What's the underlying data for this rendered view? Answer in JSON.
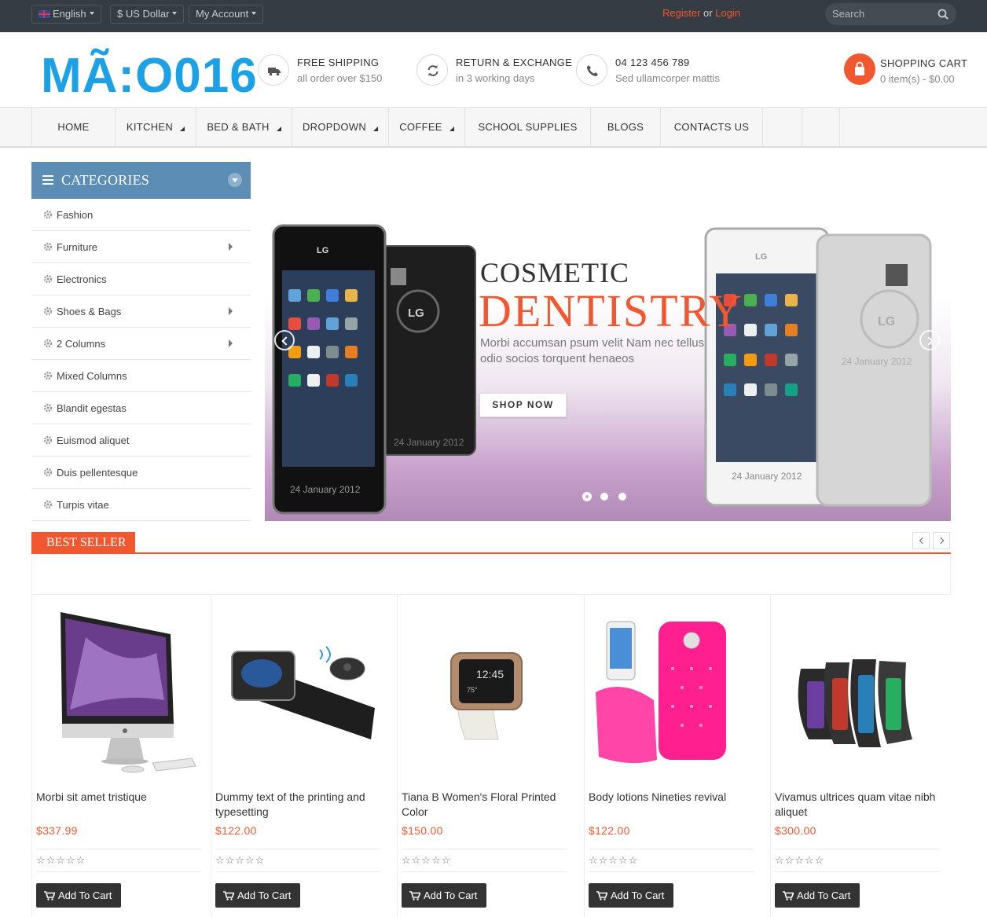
{
  "topbar": {
    "language": "English",
    "currency": "$ US Dollar",
    "account": "My Account",
    "register": "Register",
    "or": "or",
    "login": "Login",
    "search_placeholder": "Search"
  },
  "header": {
    "logo": "MÃ:O016",
    "features": [
      {
        "title": "FREE SHIPPING",
        "sub": "all order over $150",
        "icon": "truck-icon"
      },
      {
        "title": "RETURN & EXCHANGE",
        "sub": "in 3 working days",
        "icon": "refresh-icon"
      },
      {
        "title": "04 123 456 789",
        "sub": "Sed ullamcorper mattis",
        "icon": "phone-icon"
      }
    ],
    "cart_title": "SHOPPING CART",
    "cart_summary": "0 item(s) - $0.00"
  },
  "nav": {
    "items": [
      {
        "label": "HOME",
        "dropdown": false
      },
      {
        "label": "KITCHEN",
        "dropdown": true
      },
      {
        "label": "BED & BATH",
        "dropdown": true
      },
      {
        "label": "DROPDOWN",
        "dropdown": true
      },
      {
        "label": "COFFEE",
        "dropdown": true
      },
      {
        "label": "SCHOOL SUPPLIES",
        "dropdown": false
      },
      {
        "label": "BLOGS",
        "dropdown": false
      },
      {
        "label": "CONTACTS US",
        "dropdown": false
      }
    ]
  },
  "categories": {
    "title": "CATEGORIES",
    "items": [
      {
        "label": "Fashion",
        "submenu": false
      },
      {
        "label": "Furniture",
        "submenu": true
      },
      {
        "label": "Electronics",
        "submenu": false
      },
      {
        "label": "Shoes & Bags",
        "submenu": true
      },
      {
        "label": "2 Columns",
        "submenu": true
      },
      {
        "label": "Mixed Columns",
        "submenu": false
      },
      {
        "label": "Blandit egestas",
        "submenu": false
      },
      {
        "label": "Euismod aliquet",
        "submenu": false
      },
      {
        "label": "Duis pellentesque",
        "submenu": false
      },
      {
        "label": "Turpis vitae",
        "submenu": false
      }
    ]
  },
  "slider": {
    "title1": "COSMETIC",
    "title2": "DENTISTRY",
    "description": "Morbi accumsan psum velit Nam nec tellus odio socios torquent henaeos",
    "button": "SHOP NOW",
    "date_stamp": "24 January 2012",
    "active_slide": 1,
    "slide_count": 3
  },
  "best_seller": {
    "title": "BEST SELLER",
    "add_label": "Add To Cart",
    "rating_stars": "☆☆☆☆☆",
    "products": [
      {
        "name": "Morbi sit amet tristique",
        "price": "$337.99"
      },
      {
        "name": "Dummy text of the printing and typesetting",
        "price": "$122.00"
      },
      {
        "name": "Tiana B Women's Floral Printed Color",
        "price": "$150.00"
      },
      {
        "name": "Body lotions Nineties revival",
        "price": "$122.00"
      },
      {
        "name": "Vivamus ultrices quam vitae nibh aliquet",
        "price": "$300.00"
      }
    ]
  },
  "colors": {
    "accent": "#f1582f",
    "topbar": "#363c44",
    "logo": "#1da1e6",
    "categories_header": "#5b8db5"
  }
}
